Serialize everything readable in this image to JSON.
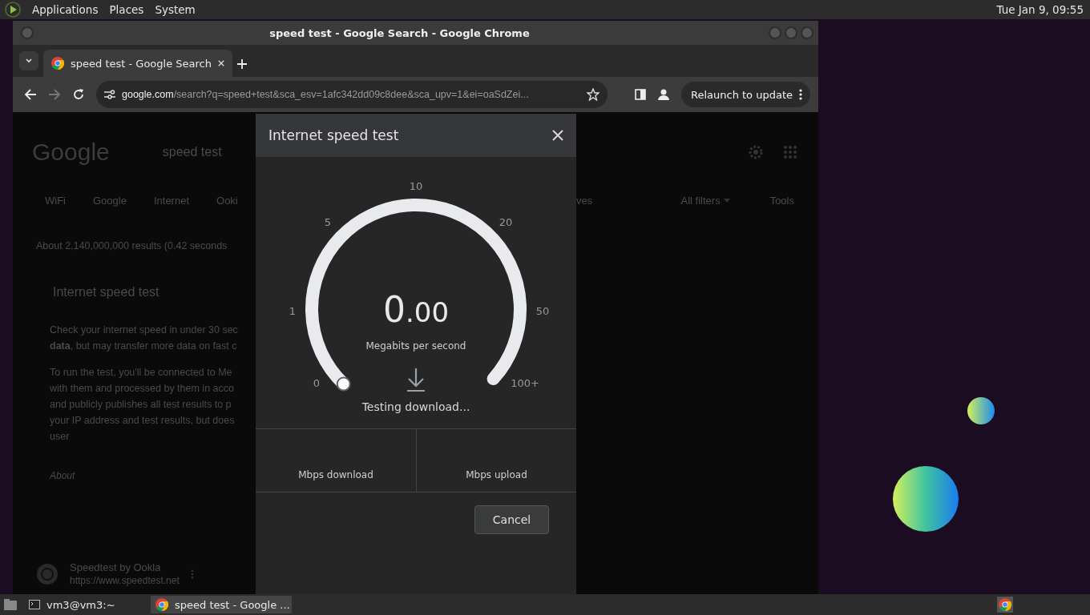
{
  "top_panel": {
    "menus": [
      "Applications",
      "Places",
      "System"
    ],
    "clock": "Tue Jan  9, 09:55"
  },
  "window": {
    "title": "speed test - Google Search - Google Chrome"
  },
  "tabs": [
    {
      "label": "speed test - Google Search",
      "selected": true
    }
  ],
  "toolbar": {
    "url_host": "google.com",
    "url_rest": "/search?q=speed+test&sca_esv=1afc342dd09c8dee&sca_upv=1&ei=oaSdZei...",
    "relaunch": "Relaunch to update"
  },
  "page": {
    "logo": "Google",
    "query": "speed test",
    "chips": [
      "WiFi",
      "Google",
      "Internet",
      "Ooki"
    ],
    "chips_right": [
      "ves"
    ],
    "all_filters": "All filters",
    "tools": "Tools",
    "stats": "About 2,140,000,000 results (0.42 seconds",
    "card_title": "Internet speed test",
    "paragraphs": [
      [
        "Check your internet speed in under 30 sec",
        "**data**, but may transfer more data on fast c"
      ],
      [
        "To run the test, you'll be connected to Me",
        "with them and processed by them in acco",
        "and publicly publishes all test results to p",
        "your IP address and test results, but does",
        "user"
      ]
    ],
    "about": "About",
    "result_title": "Speedtest by Ookla",
    "result_url": "https://www.speedtest.net"
  },
  "dialog": {
    "title": "Internet speed test",
    "gauge": {
      "ticks": [
        "0",
        "1",
        "5",
        "10",
        "20",
        "50",
        "100+"
      ],
      "reading": "0.00",
      "unit": "Megabits per second",
      "status": "Testing download..."
    },
    "results": [
      "Mbps download",
      "Mbps upload"
    ],
    "cancel": "Cancel"
  },
  "taskbar": [
    {
      "label": "vm3@vm3:~",
      "kind": "terminal",
      "selected": false
    },
    {
      "label": "speed test - Google ...",
      "kind": "browser",
      "selected": true
    }
  ]
}
